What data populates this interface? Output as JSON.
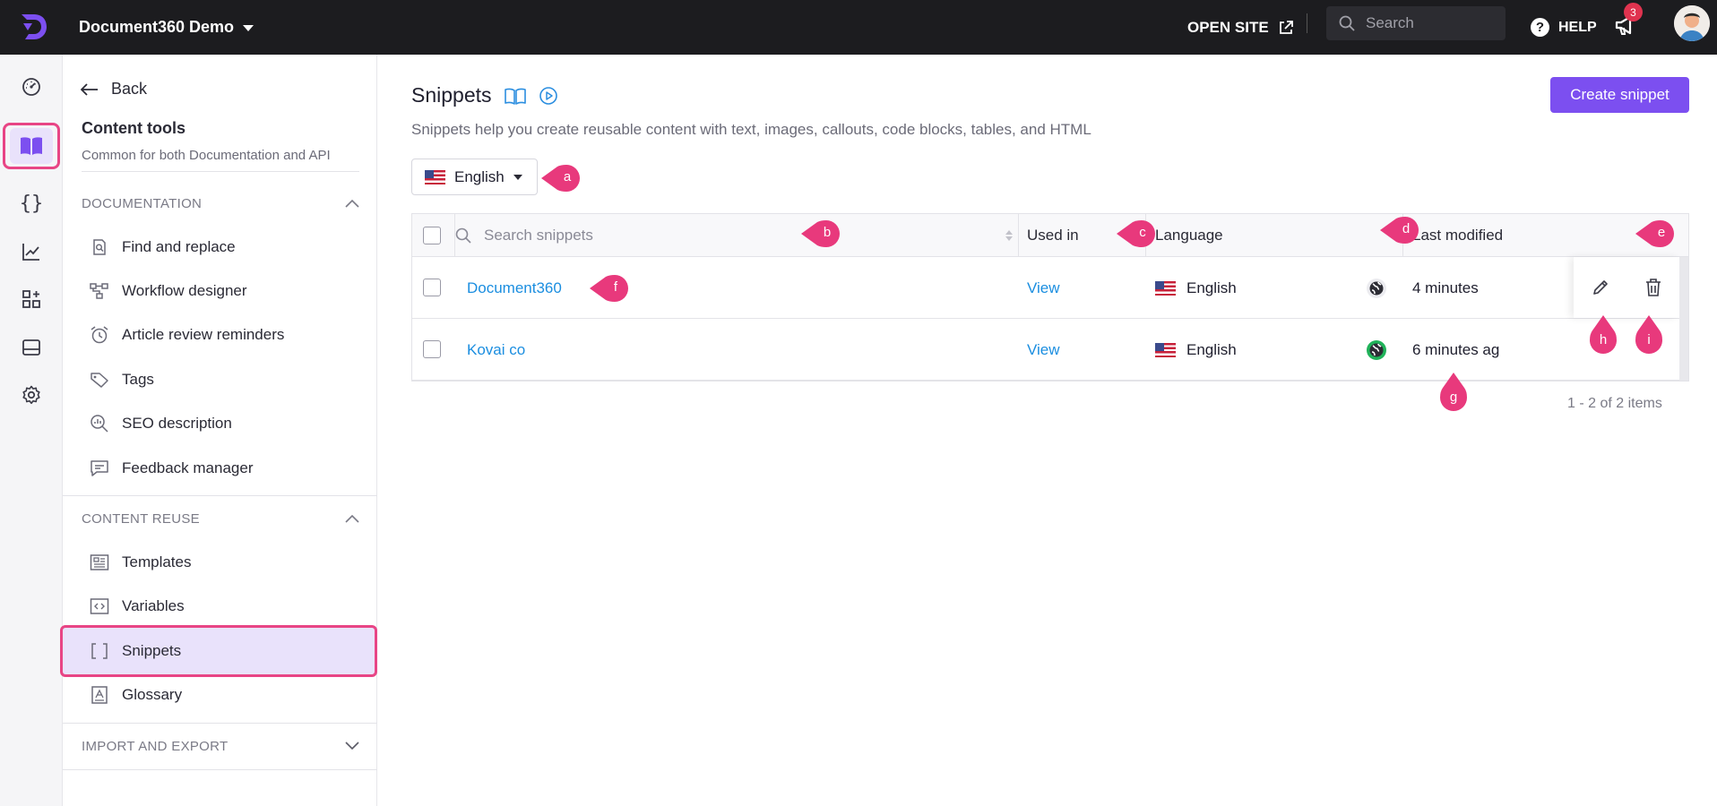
{
  "topbar": {
    "project_name": "Document360 Demo",
    "open_site_label": "OPEN SITE",
    "search_placeholder": "Search",
    "help_label": "HELP",
    "notification_count": "3"
  },
  "rail": {
    "items": [
      "dashboard-icon",
      "documentation-icon",
      "api-icon",
      "analytics-icon",
      "integrations-icon",
      "widgets-icon",
      "settings-icon"
    ],
    "active": "documentation-icon"
  },
  "sidebar": {
    "back_label": "Back",
    "title": "Content tools",
    "subtitle": "Common for both Documentation and API",
    "sections": {
      "documentation": {
        "label": "DOCUMENTATION",
        "items": [
          {
            "label": "Find and replace",
            "icon": "find-replace-icon"
          },
          {
            "label": "Workflow designer",
            "icon": "workflow-icon"
          },
          {
            "label": "Article review reminders",
            "icon": "alarm-icon"
          },
          {
            "label": "Tags",
            "icon": "tag-icon"
          },
          {
            "label": "SEO description",
            "icon": "seo-icon"
          },
          {
            "label": "Feedback manager",
            "icon": "feedback-icon"
          }
        ]
      },
      "content_reuse": {
        "label": "CONTENT REUSE",
        "items": [
          {
            "label": "Templates",
            "icon": "template-icon"
          },
          {
            "label": "Variables",
            "icon": "variable-icon"
          },
          {
            "label": "Snippets",
            "icon": "snippet-icon"
          },
          {
            "label": "Glossary",
            "icon": "glossary-icon"
          }
        ],
        "active": "Snippets"
      },
      "import_export": {
        "label": "IMPORT AND EXPORT"
      }
    }
  },
  "main": {
    "title": "Snippets",
    "description": "Snippets help you create reusable content with text, images, callouts, code blocks, tables, and HTML",
    "create_button": "Create snippet",
    "language_select": "English",
    "table": {
      "search_placeholder": "Search snippets",
      "headers": {
        "used_in": "Used in",
        "language": "Language",
        "last_modified": "Last modified"
      },
      "rows": [
        {
          "name": "Document360",
          "used_in": "View",
          "language": "English",
          "status": "gray",
          "last_modified": "4 minutes"
        },
        {
          "name": "Kovai co",
          "used_in": "View",
          "language": "English",
          "status": "green",
          "last_modified": "6 minutes ag"
        }
      ]
    },
    "pager": "1 - 2 of 2 items"
  },
  "annotations": {
    "a": "a",
    "b": "b",
    "c": "c",
    "d": "d",
    "e": "e",
    "f": "f",
    "g": "g",
    "h": "h",
    "i": "i"
  },
  "colors": {
    "accent": "#7c4ff0",
    "highlight": "#e84585",
    "link": "#1b8ee0",
    "topbar": "#1c1c1f"
  }
}
